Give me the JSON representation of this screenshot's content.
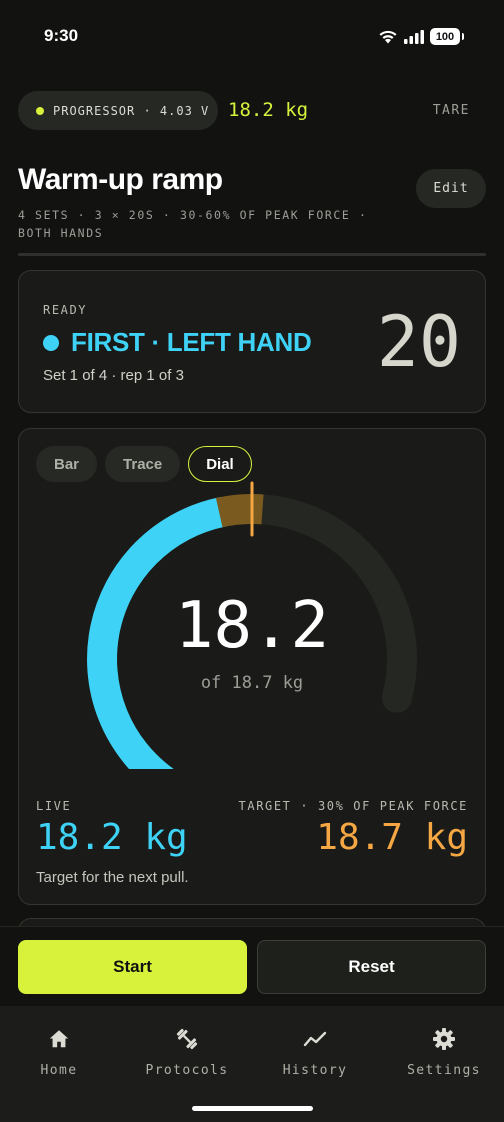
{
  "status_bar": {
    "time": "9:30",
    "battery": "100"
  },
  "device": {
    "label": "PROGRESSOR · 4.03 V",
    "weight": "18.2 kg",
    "tare_label": "TARE"
  },
  "protocol": {
    "title": "Warm-up ramp",
    "edit_label": "Edit",
    "meta": "4 SETS · 3 × 20S · 30-60% OF PEAK FORCE · BOTH HANDS"
  },
  "ready": {
    "label": "READY",
    "phase": "FIRST · LEFT HAND",
    "progress": "Set 1 of 4 · rep 1 of 3",
    "countdown": "20"
  },
  "gauge": {
    "tabs": [
      {
        "label": "Bar",
        "active": false
      },
      {
        "label": "Trace",
        "active": false
      },
      {
        "label": "Dial",
        "active": true
      }
    ],
    "value": "18.2",
    "subtitle": "of 18.7 kg",
    "fill_fraction": 0.97,
    "live_label": "LIVE",
    "live_value": "18.2 kg",
    "target_label": "TARGET · 30% OF PEAK FORCE",
    "target_value": "18.7 kg",
    "hint": "Target for the next pull."
  },
  "actions": {
    "start_label": "Start",
    "reset_label": "Reset"
  },
  "tabs": [
    {
      "label": "Home",
      "icon": "home-icon"
    },
    {
      "label": "Protocols",
      "icon": "dumbbell-icon"
    },
    {
      "label": "History",
      "icon": "trend-icon"
    },
    {
      "label": "Settings",
      "icon": "gear-icon"
    }
  ],
  "colors": {
    "accent": "#d8f23c",
    "live": "#3ed3f6",
    "target": "#f5a743",
    "background": "#121311"
  }
}
